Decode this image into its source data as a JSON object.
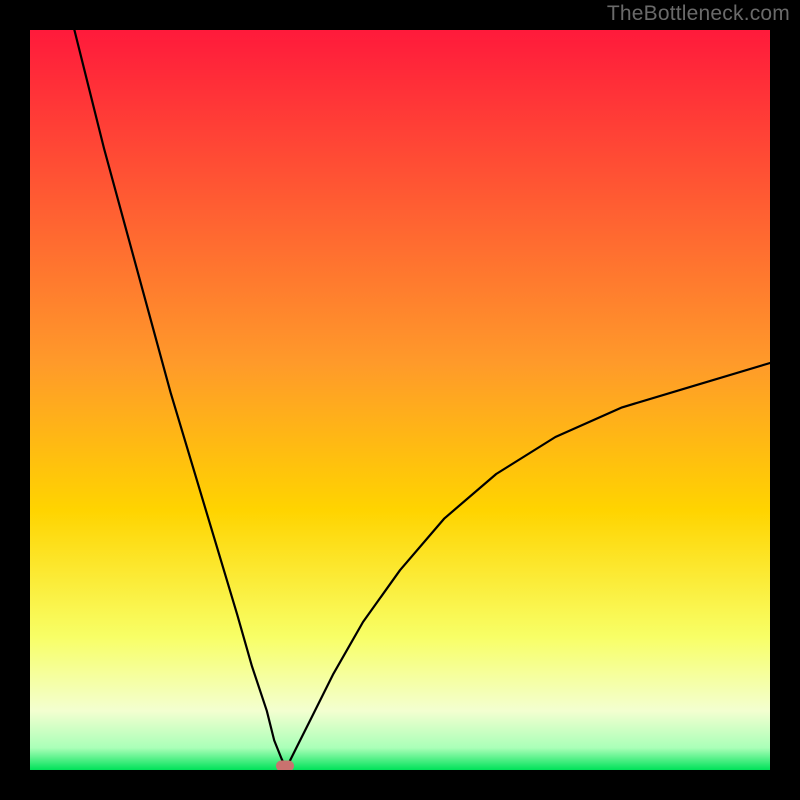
{
  "watermark": "TheBottleneck.com",
  "colors": {
    "black": "#000000",
    "gradient_top": "#ff1a3b",
    "gradient_mid_upper": "#ff7a2a",
    "gradient_mid": "#ffd400",
    "gradient_lower": "#f8ff66",
    "gradient_pale": "#f3ffd0",
    "gradient_green": "#00e25a",
    "marker": "#c9726f",
    "curve": "#000000"
  },
  "chart_data": {
    "type": "line",
    "title": "",
    "xlabel": "",
    "ylabel": "",
    "xlim": [
      0,
      100
    ],
    "ylim": [
      0,
      100
    ],
    "grid": false,
    "legend": false,
    "series": [
      {
        "name": "bottleneck-curve",
        "x": [
          6,
          8,
          10,
          13,
          16,
          19,
          22,
          25,
          28,
          30,
          32,
          33,
          34,
          34.5,
          35,
          36,
          38,
          41,
          45,
          50,
          56,
          63,
          71,
          80,
          90,
          100
        ],
        "y": [
          100,
          92,
          84,
          73,
          62,
          51,
          41,
          31,
          21,
          14,
          8,
          4,
          1.5,
          0.5,
          1,
          3,
          7,
          13,
          20,
          27,
          34,
          40,
          45,
          49,
          52,
          55
        ]
      }
    ],
    "annotations": [
      {
        "name": "min-marker",
        "x": 34.5,
        "y": 0.5
      }
    ],
    "background_gradient_stops": [
      {
        "pct": 0,
        "color": "#ff1a3b"
      },
      {
        "pct": 45,
        "color": "#ff9a2a"
      },
      {
        "pct": 65,
        "color": "#ffd400"
      },
      {
        "pct": 82,
        "color": "#f8ff66"
      },
      {
        "pct": 92,
        "color": "#f3ffd0"
      },
      {
        "pct": 97,
        "color": "#aaffb8"
      },
      {
        "pct": 100,
        "color": "#00e25a"
      }
    ]
  }
}
